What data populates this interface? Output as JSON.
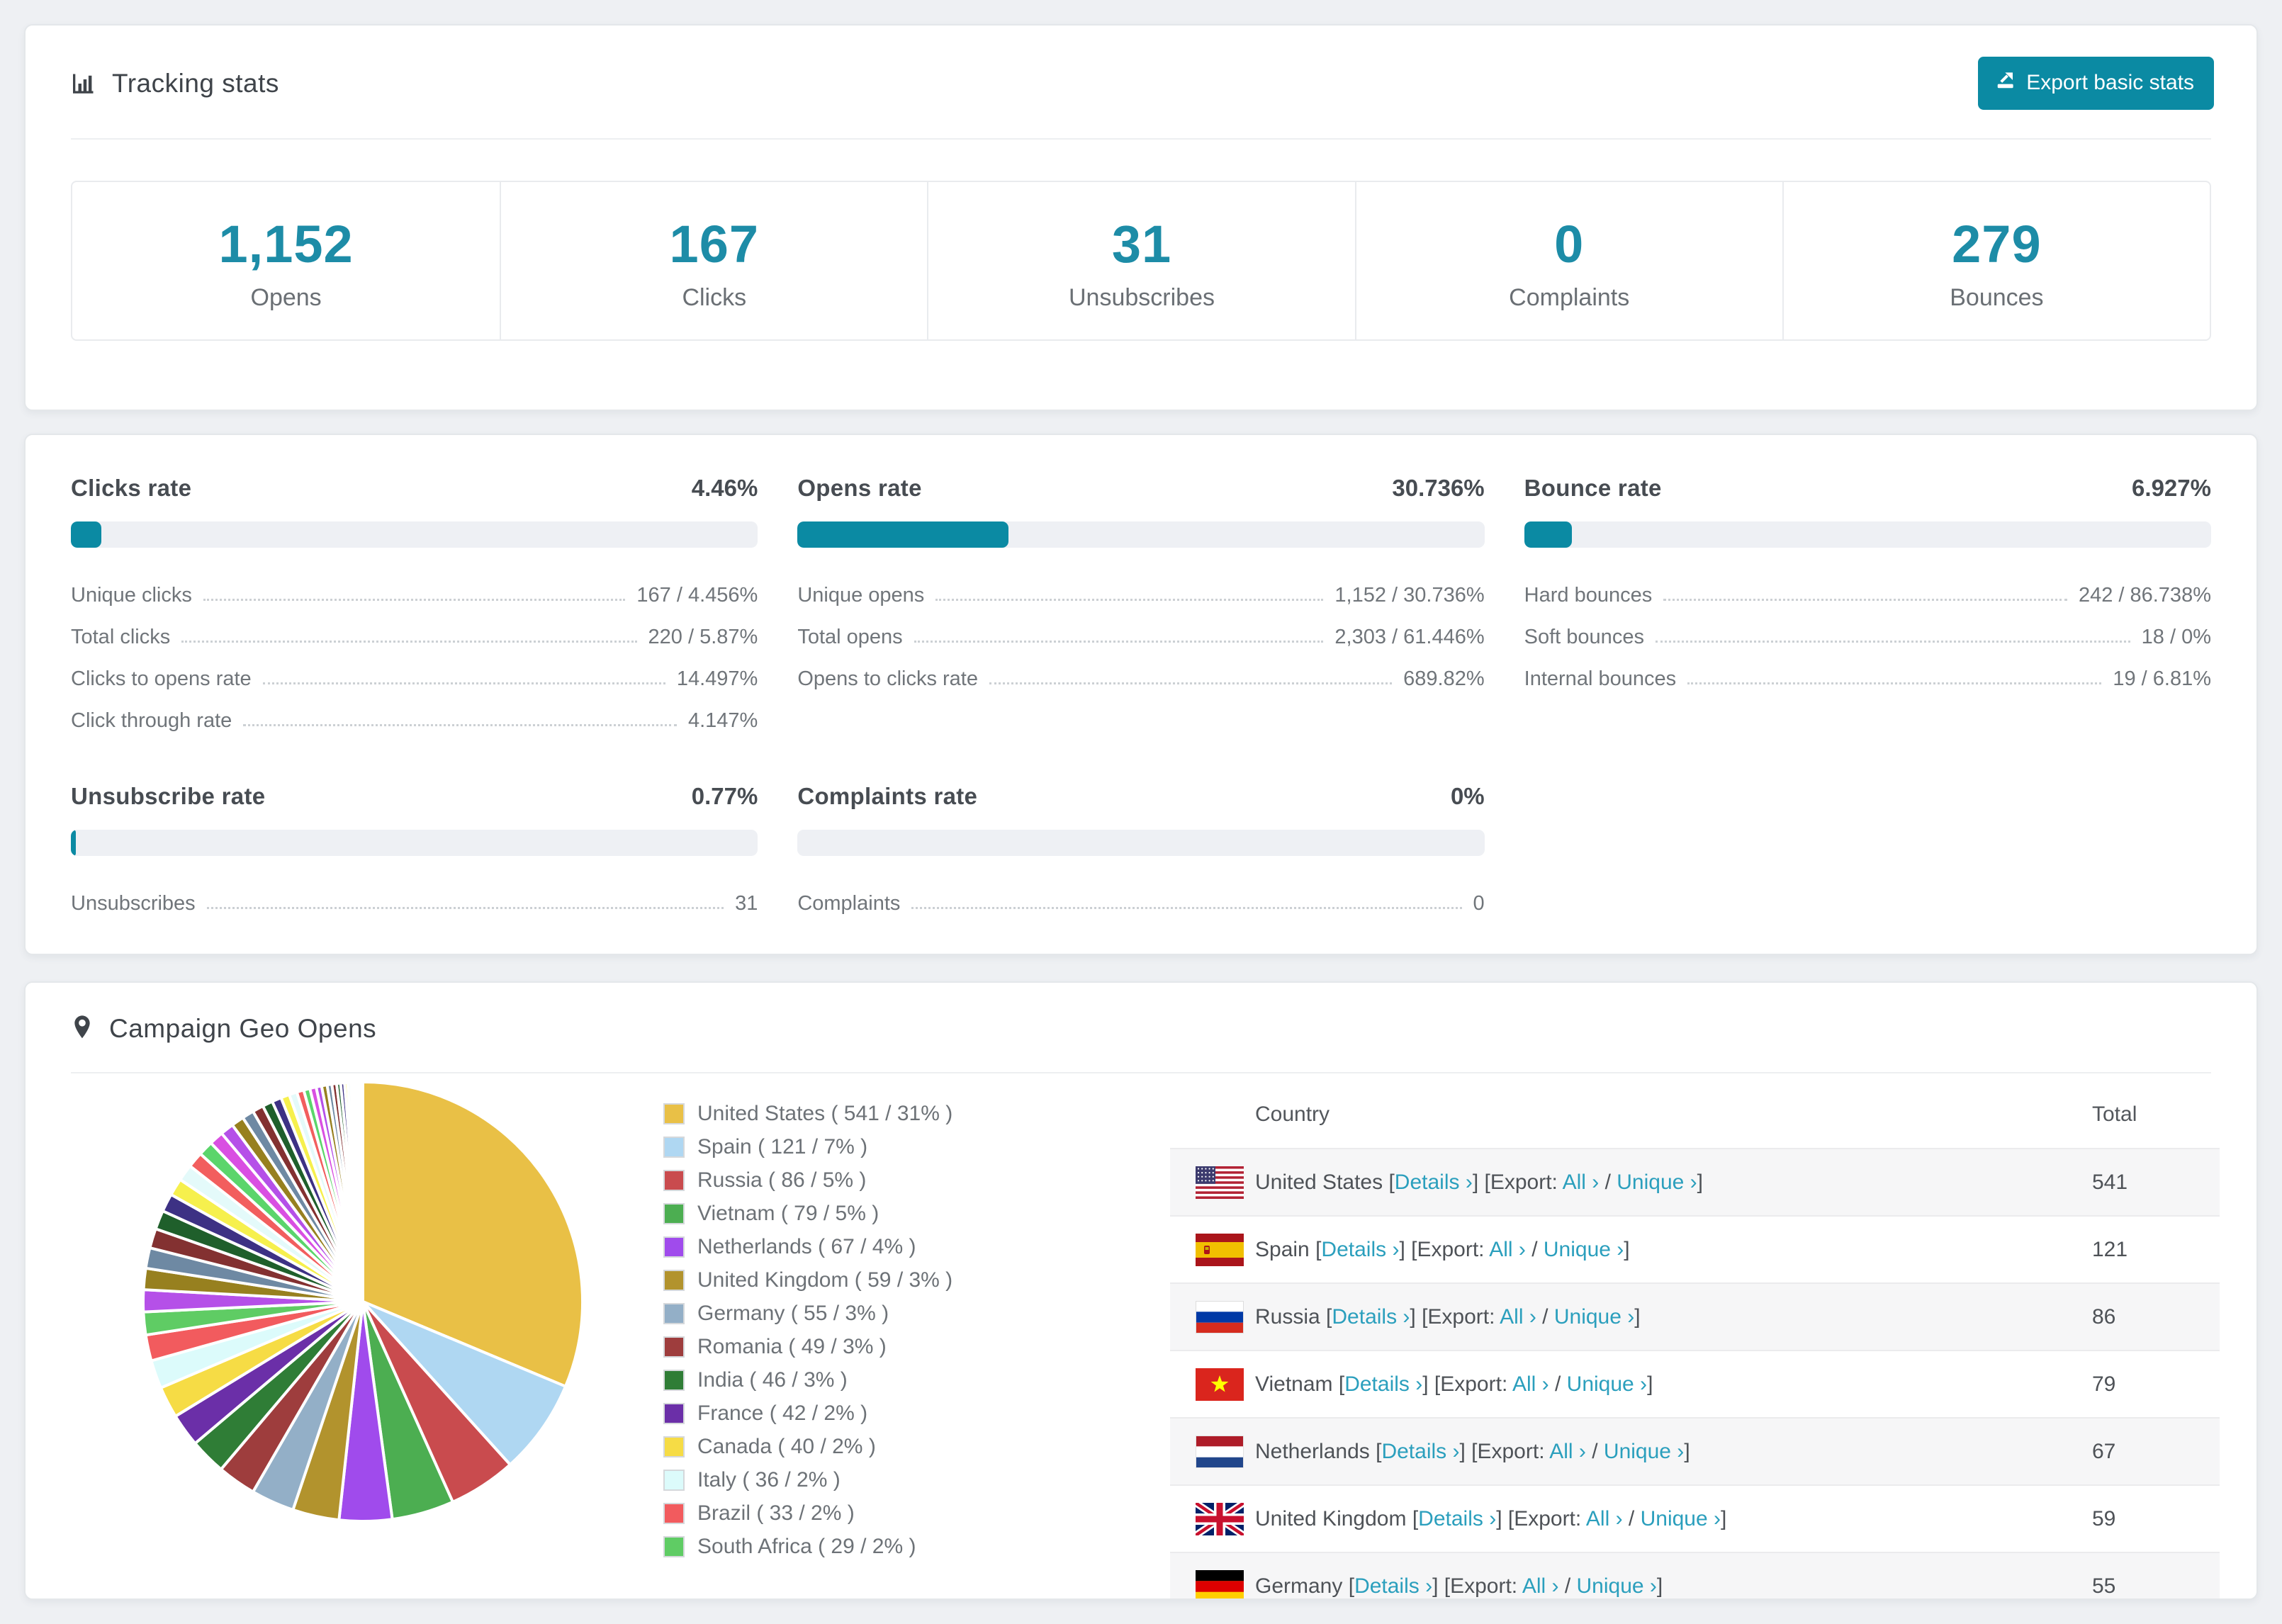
{
  "colors": {
    "accent_teal": "#0b8aa3",
    "number_teal": "#1d8ca7",
    "link_teal": "#2b9fbd",
    "bar_track": "#eef0f4",
    "page_bg": "#eef0f3",
    "row_alt_bg": "#f6f6f7"
  },
  "tracking": {
    "title": "Tracking stats",
    "export_label": "Export basic stats",
    "stats": [
      {
        "value": "1,152",
        "label": "Opens"
      },
      {
        "value": "167",
        "label": "Clicks"
      },
      {
        "value": "31",
        "label": "Unsubscribes"
      },
      {
        "value": "0",
        "label": "Complaints"
      },
      {
        "value": "279",
        "label": "Bounces"
      }
    ]
  },
  "rates": {
    "sections": [
      {
        "id": "clicks",
        "title": "Clicks rate",
        "value": "4.46%",
        "percent": 4.46,
        "rows": [
          [
            "Unique clicks",
            "167 / 4.456%"
          ],
          [
            "Total clicks",
            "220 / 5.87%"
          ],
          [
            "Clicks to opens rate",
            "14.497%"
          ],
          [
            "Click through rate",
            "4.147%"
          ]
        ]
      },
      {
        "id": "opens",
        "title": "Opens rate",
        "value": "30.736%",
        "percent": 30.736,
        "rows": [
          [
            "Unique opens",
            "1,152 / 30.736%"
          ],
          [
            "Total opens",
            "2,303 / 61.446%"
          ],
          [
            "Opens to clicks rate",
            "689.82%"
          ]
        ]
      },
      {
        "id": "bounce",
        "title": "Bounce rate",
        "value": "6.927%",
        "percent": 6.927,
        "rows": [
          [
            "Hard bounces",
            "242 / 86.738%"
          ],
          [
            "Soft bounces",
            "18 / 0%"
          ],
          [
            "Internal bounces",
            "19 / 6.81%"
          ]
        ]
      },
      {
        "id": "unsubscribe",
        "title": "Unsubscribe rate",
        "value": "0.77%",
        "percent": 0.77,
        "rows": [
          [
            "Unsubscribes",
            "31"
          ]
        ]
      },
      {
        "id": "complaints",
        "title": "Complaints rate",
        "value": "0%",
        "percent": 0,
        "rows": [
          [
            "Complaints",
            "0"
          ]
        ]
      }
    ]
  },
  "geo": {
    "title": "Campaign Geo Opens",
    "table": {
      "headers": [
        "Country",
        "Total"
      ],
      "link_details": "Details ›",
      "link_all": "All ›",
      "link_unique": "Unique ›",
      "punct": {
        "open": "[",
        "close": "]",
        "export_prefix": "[Export:",
        "slash": "/"
      },
      "rows": [
        {
          "country": "United States",
          "flag": "us",
          "total": "541"
        },
        {
          "country": "Spain",
          "flag": "es",
          "total": "121"
        },
        {
          "country": "Russia",
          "flag": "ru",
          "total": "86"
        },
        {
          "country": "Vietnam",
          "flag": "vn",
          "total": "79"
        },
        {
          "country": "Netherlands",
          "flag": "nl",
          "total": "67"
        },
        {
          "country": "United Kingdom",
          "flag": "gb",
          "total": "59"
        },
        {
          "country": "Germany",
          "flag": "de",
          "total": "55"
        }
      ]
    }
  },
  "chart_data": {
    "type": "pie",
    "title": "Campaign Geo Opens",
    "legend_position": "right",
    "start_angle_deg": 0,
    "direction": "clockwise",
    "slices": [
      {
        "label": "United States",
        "value": 541,
        "pct": "31%",
        "color": "#E9C046"
      },
      {
        "label": "Spain",
        "value": 121,
        "pct": "7%",
        "color": "#AFD7F2"
      },
      {
        "label": "Russia",
        "value": 86,
        "pct": "5%",
        "color": "#C94B4E"
      },
      {
        "label": "Vietnam",
        "value": 79,
        "pct": "5%",
        "color": "#4CAE51"
      },
      {
        "label": "Netherlands",
        "value": 67,
        "pct": "4%",
        "color": "#A04BEC"
      },
      {
        "label": "United Kingdom",
        "value": 59,
        "pct": "3%",
        "color": "#B2932D"
      },
      {
        "label": "Germany",
        "value": 55,
        "pct": "3%",
        "color": "#93AFC7"
      },
      {
        "label": "Romania",
        "value": 49,
        "pct": "3%",
        "color": "#9E3D3D"
      },
      {
        "label": "India",
        "value": 46,
        "pct": "3%",
        "color": "#2F7D36"
      },
      {
        "label": "France",
        "value": 42,
        "pct": "2%",
        "color": "#6B2FA8"
      },
      {
        "label": "Canada",
        "value": 40,
        "pct": "2%",
        "color": "#F6DC45"
      },
      {
        "label": "Italy",
        "value": 36,
        "pct": "2%",
        "color": "#DCFBFB"
      },
      {
        "label": "Brazil",
        "value": 33,
        "pct": "2%",
        "color": "#F25B5E"
      },
      {
        "label": "South Africa",
        "value": 29,
        "pct": "2%",
        "color": "#5FCC64"
      }
    ],
    "legend_format": "{label} ( {value} / {pct} )",
    "other_slices": {
      "note": "unlabeled remaining countries, decreasing slivers",
      "values": [
        28,
        27,
        26,
        25,
        24,
        23,
        22,
        21,
        20,
        19,
        18,
        17,
        16,
        15,
        14,
        13,
        12,
        11,
        10,
        9,
        8,
        8,
        7,
        7,
        6,
        6,
        5,
        5,
        4,
        4,
        3,
        3,
        2,
        2,
        2,
        1,
        1,
        1
      ],
      "palette": [
        "#B550E8",
        "#97801F",
        "#6E89A3",
        "#833131",
        "#1F5F2B",
        "#3D3184",
        "#F6F04D",
        "#E4FAFA",
        "#F25E5E",
        "#5BD56B",
        "#D94FE2"
      ]
    }
  }
}
